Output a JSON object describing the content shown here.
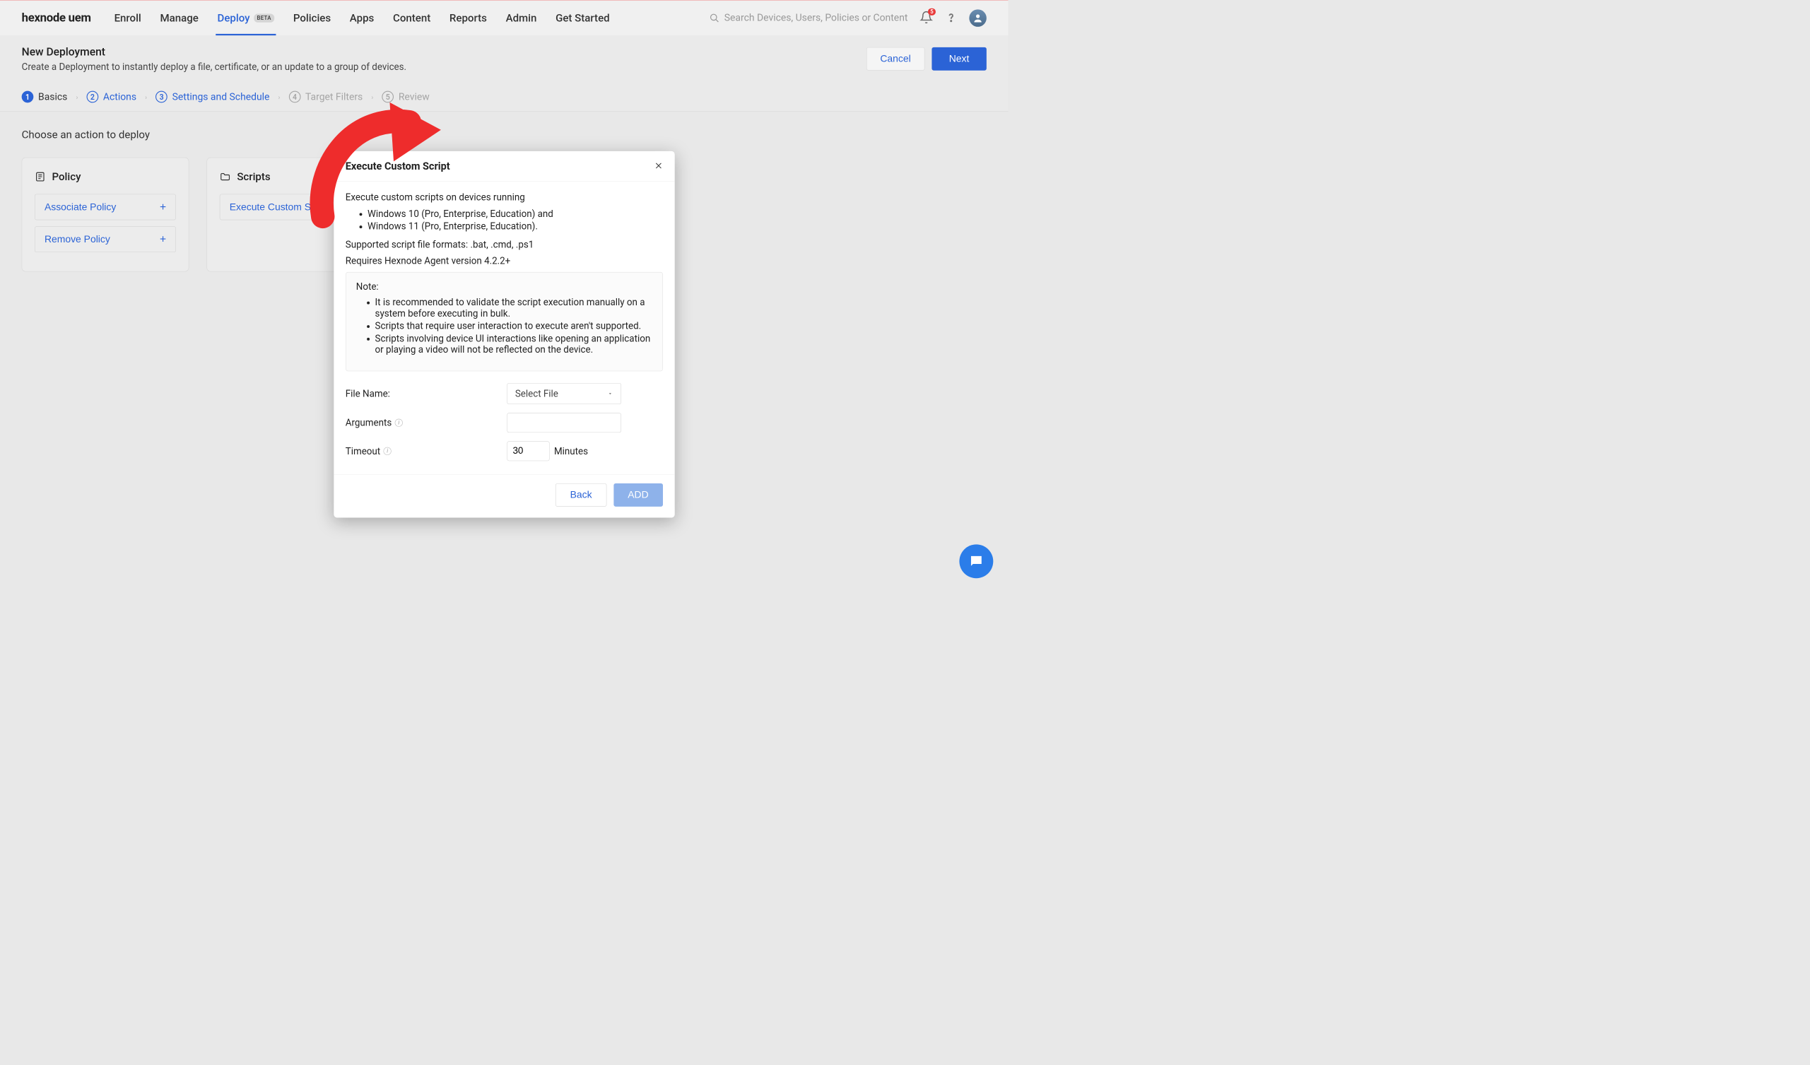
{
  "brand": "hexnode uem",
  "nav": {
    "items": [
      "Enroll",
      "Manage",
      "Deploy",
      "Policies",
      "Apps",
      "Content",
      "Reports",
      "Admin",
      "Get Started"
    ],
    "active": "Deploy",
    "beta_label": "BETA"
  },
  "search": {
    "placeholder": "Search Devices, Users, Policies or Content"
  },
  "notifications": {
    "count": "5"
  },
  "subheader": {
    "title": "New Deployment",
    "desc": "Create a Deployment to instantly deploy a file, certificate, or an update to a group of devices.",
    "cancel": "Cancel",
    "next": "Next"
  },
  "steps": [
    {
      "n": "1",
      "label": "Basics",
      "state": "current"
    },
    {
      "n": "2",
      "label": "Actions",
      "state": "link"
    },
    {
      "n": "3",
      "label": "Settings and Schedule",
      "state": "link"
    },
    {
      "n": "4",
      "label": "Target Filters",
      "state": "disabled"
    },
    {
      "n": "5",
      "label": "Review",
      "state": "disabled"
    }
  ],
  "content": {
    "heading": "Choose an action to deploy",
    "policy_card": {
      "title": "Policy",
      "actions": [
        "Associate Policy",
        "Remove Policy"
      ]
    },
    "scripts_card": {
      "title": "Scripts",
      "actions": [
        "Execute Custom Script"
      ]
    }
  },
  "modal": {
    "title": "Execute Custom Script",
    "intro": "Execute custom scripts on devices running",
    "os_list": [
      "Windows 10 (Pro, Enterprise, Education) and",
      "Windows 11 (Pro, Enterprise, Education)."
    ],
    "formats": "Supported script file formats: .bat, .cmd, .ps1",
    "agent": "Requires Hexnode Agent version 4.2.2+",
    "note_label": "Note:",
    "notes": [
      "It is recommended to validate the script execution manually on a system before executing in bulk.",
      "Scripts that require user interaction to execute aren't supported.",
      "Scripts involving device UI interactions like opening an application or playing a video will not be reflected on the device."
    ],
    "file_label": "File Name:",
    "file_select": "Select File",
    "args_label": "Arguments",
    "timeout_label": "Timeout",
    "timeout_value": "30",
    "timeout_unit": "Minutes",
    "back": "Back",
    "add": "ADD"
  }
}
